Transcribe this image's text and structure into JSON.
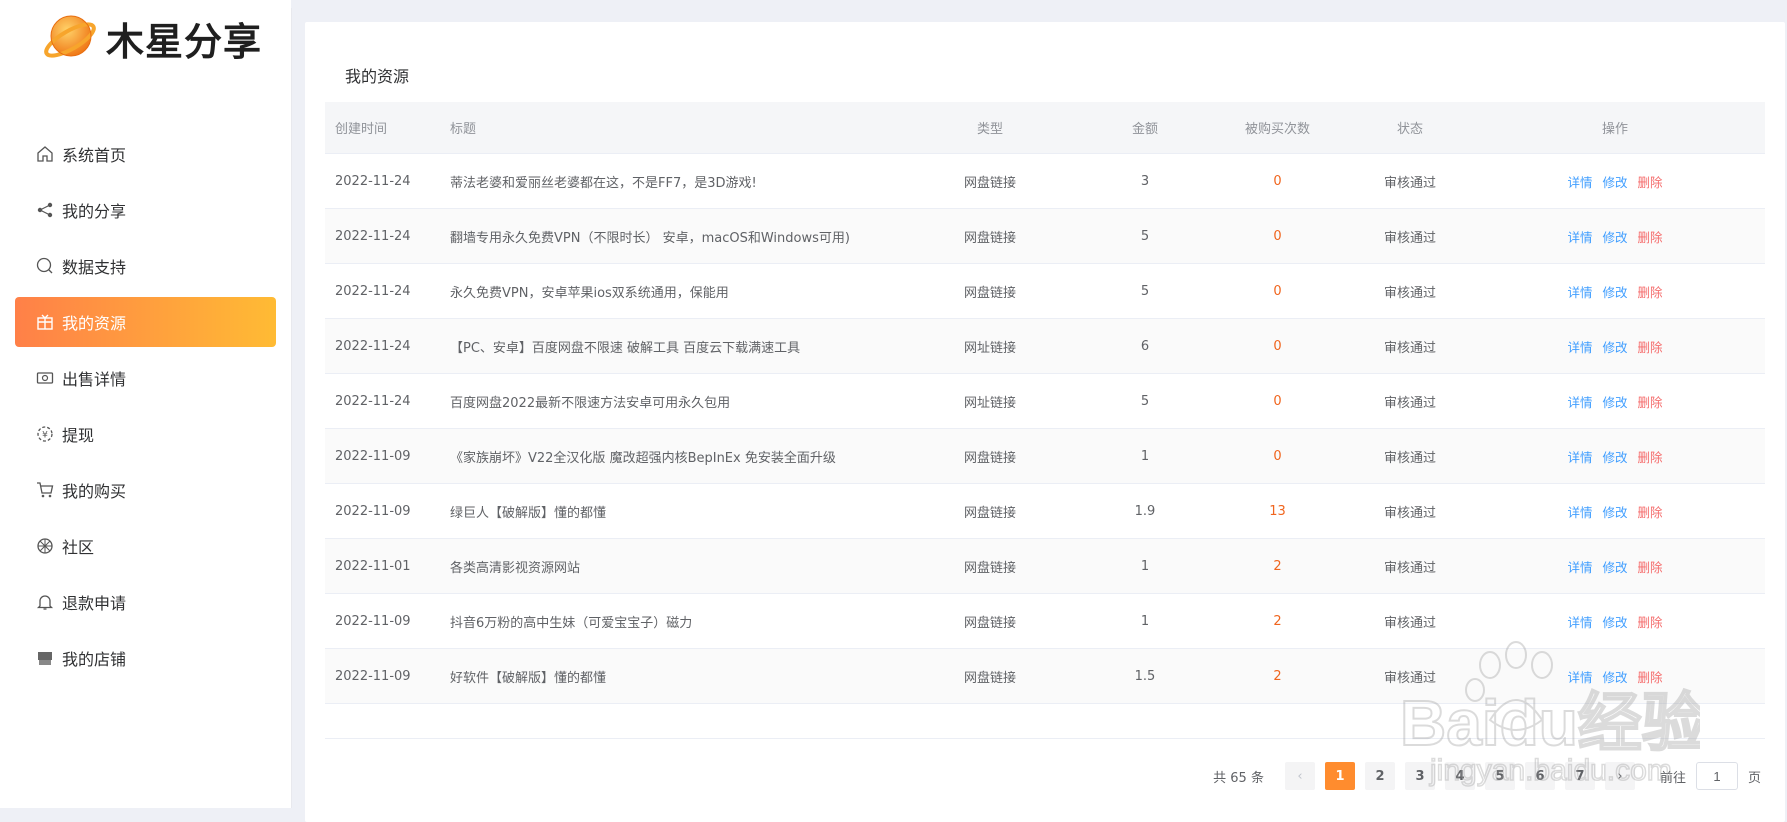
{
  "brand": {
    "name": "木星分享"
  },
  "sidebar": {
    "items": [
      {
        "label": "系统首页",
        "icon": "home-icon",
        "active": false
      },
      {
        "label": "我的分享",
        "icon": "share-icon",
        "active": false
      },
      {
        "label": "数据支持",
        "icon": "search-icon",
        "active": false
      },
      {
        "label": "我的资源",
        "icon": "grid-icon",
        "active": true
      },
      {
        "label": "出售详情",
        "icon": "money-icon",
        "active": false
      },
      {
        "label": "提现",
        "icon": "wallet-icon",
        "active": false
      },
      {
        "label": "我的购买",
        "icon": "cart-icon",
        "active": false
      },
      {
        "label": "社区",
        "icon": "community-icon",
        "active": false
      },
      {
        "label": "退款申请",
        "icon": "bell-icon",
        "active": false
      },
      {
        "label": "我的店铺",
        "icon": "store-icon",
        "active": false
      }
    ]
  },
  "main": {
    "title": "我的资源",
    "columns": [
      "创建时间",
      "标题",
      "类型",
      "金额",
      "被购买次数",
      "状态",
      "操作"
    ],
    "rows": [
      {
        "date": "2022-11-24",
        "title": "蒂法老婆和爱丽丝老婆都在这，不是FF7，是3D游戏!",
        "type": "网盘链接",
        "amount": "3",
        "count": "0",
        "status": "审核通过"
      },
      {
        "date": "2022-11-24",
        "title": "翻墙专用永久免费VPN（不限时长） 安卓，macOS和Windows可用)",
        "type": "网盘链接",
        "amount": "5",
        "count": "0",
        "status": "审核通过"
      },
      {
        "date": "2022-11-24",
        "title": "永久免费VPN，安卓苹果ios双系统通用，保能用",
        "type": "网盘链接",
        "amount": "5",
        "count": "0",
        "status": "审核通过"
      },
      {
        "date": "2022-11-24",
        "title": "【PC、安卓】百度网盘不限速 破解工具 百度云下载满速工具",
        "type": "网址链接",
        "amount": "6",
        "count": "0",
        "status": "审核通过"
      },
      {
        "date": "2022-11-24",
        "title": "百度网盘2022最新不限速方法安卓可用永久包用",
        "type": "网址链接",
        "amount": "5",
        "count": "0",
        "status": "审核通过"
      },
      {
        "date": "2022-11-09",
        "title": "《家族崩坏》V22全汉化版 魔改超强内核BepInEx 免安装全面升级",
        "type": "网盘链接",
        "amount": "1",
        "count": "0",
        "status": "审核通过"
      },
      {
        "date": "2022-11-09",
        "title": "绿巨人【破解版】懂的都懂",
        "type": "网盘链接",
        "amount": "1.9",
        "count": "13",
        "status": "审核通过"
      },
      {
        "date": "2022-11-01",
        "title": "各类高清影视资源网站",
        "type": "网盘链接",
        "amount": "1",
        "count": "2",
        "status": "审核通过"
      },
      {
        "date": "2022-11-09",
        "title": "抖音6万粉的高中生妹（可爱宝宝子）磁力",
        "type": "网盘链接",
        "amount": "1",
        "count": "2",
        "status": "审核通过"
      },
      {
        "date": "2022-11-09",
        "title": "好软件【破解版】懂的都懂",
        "type": "网盘链接",
        "amount": "1.5",
        "count": "2",
        "status": "审核通过"
      }
    ],
    "actions": {
      "detail": "详情",
      "edit": "修改",
      "delete": "删除"
    }
  },
  "pagination": {
    "total_label": "共 65 条",
    "pages": [
      "1",
      "2",
      "3",
      "4",
      "5",
      "6",
      "7"
    ],
    "current": "1",
    "goto_prefix": "前往",
    "goto_value": "1",
    "goto_suffix": "页"
  },
  "watermark": {
    "text": "Baidu经验",
    "url_text": "jingyan.baidu.com"
  },
  "colors": {
    "accent_start": "#ff8048",
    "accent_end": "#ffbb34",
    "link": "#409eff",
    "danger": "#f56c6c",
    "count": "#f0651e"
  }
}
